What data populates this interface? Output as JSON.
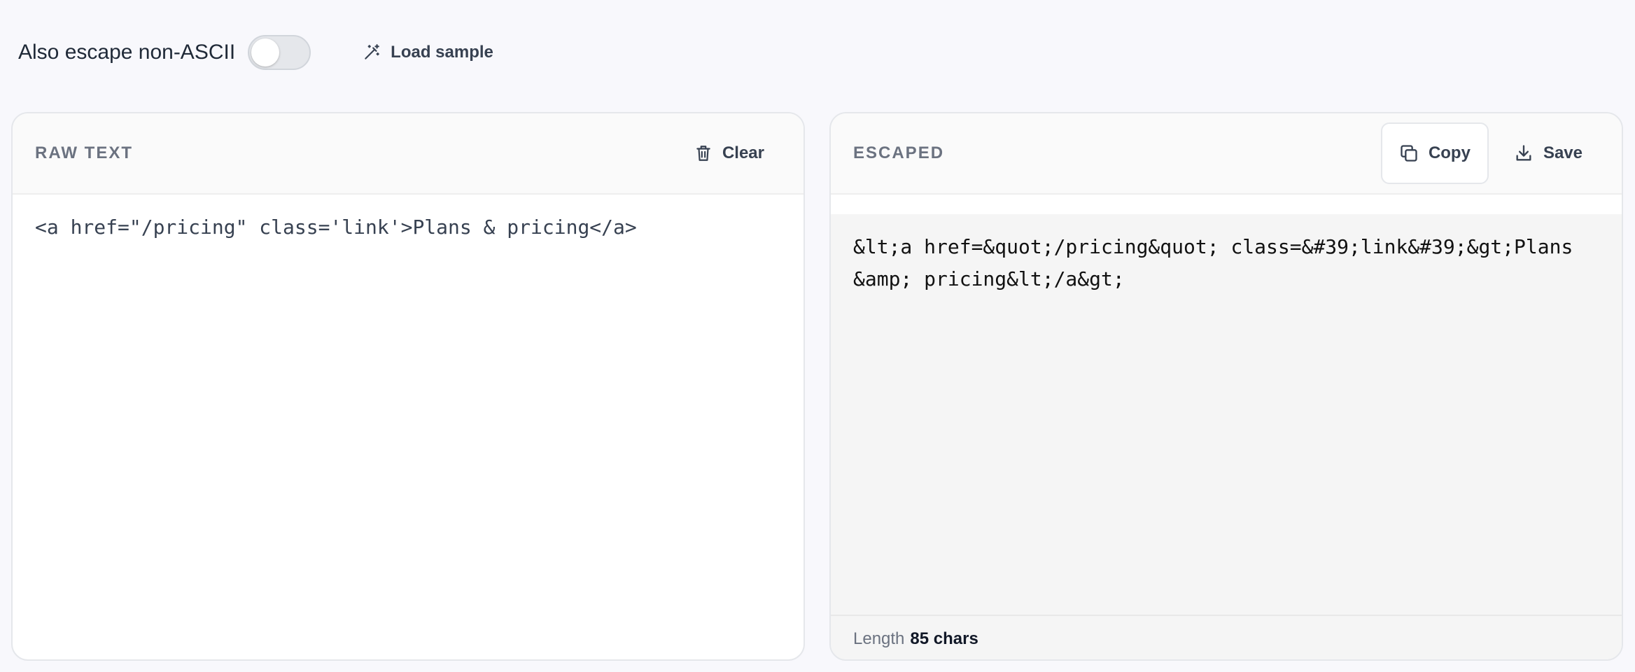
{
  "toolbar": {
    "escape_label": "Also escape non-ASCII",
    "escape_toggle_on": false,
    "load_sample_label": "Load sample"
  },
  "raw_panel": {
    "title": "RAW TEXT",
    "clear_label": "Clear",
    "text": "<a href=\"/pricing\" class='link'>Plans & pricing</a>"
  },
  "escaped_panel": {
    "title": "ESCAPED",
    "copy_label": "Copy",
    "save_label": "Save",
    "text": "&lt;a href=&quot;/pricing&quot; class=&#39;link&#39;&gt;Plans\n&amp; pricing&lt;/a&gt;",
    "length_label": "Length",
    "length_value": "85 chars"
  },
  "icons": {
    "load_sample": "magic-wand-icon",
    "clear": "trash-icon",
    "copy": "copy-icon",
    "save": "download-icon"
  }
}
